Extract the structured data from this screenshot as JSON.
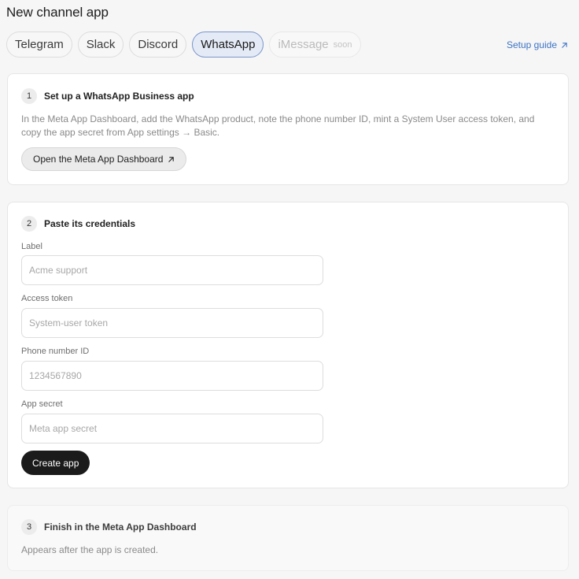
{
  "page": {
    "title": "New channel app"
  },
  "tabs": [
    {
      "label": "Telegram",
      "state": "default"
    },
    {
      "label": "Slack",
      "state": "default"
    },
    {
      "label": "Discord",
      "state": "default"
    },
    {
      "label": "WhatsApp",
      "state": "active"
    },
    {
      "label": "iMessage",
      "state": "disabled",
      "badge": "soon"
    }
  ],
  "setup_guide": {
    "label": "Setup guide",
    "icon": "arrow-up-right-icon"
  },
  "step1": {
    "number": "1",
    "title": "Set up a WhatsApp Business app",
    "description": "In the Meta App Dashboard, add the WhatsApp product, note the phone number ID, mint a System User access token, and copy the app secret from App settings → Basic.",
    "button_label": "Open the Meta App Dashboard",
    "button_icon": "arrow-up-right-icon"
  },
  "step2": {
    "number": "2",
    "title": "Paste its credentials",
    "fields": [
      {
        "label": "Label",
        "placeholder": "Acme support",
        "value": ""
      },
      {
        "label": "Access token",
        "placeholder": "System-user token",
        "value": ""
      },
      {
        "label": "Phone number ID",
        "placeholder": "1234567890",
        "value": ""
      },
      {
        "label": "App secret",
        "placeholder": "Meta app secret",
        "value": ""
      }
    ],
    "submit_label": "Create app"
  },
  "step3": {
    "number": "3",
    "title": "Finish in the Meta App Dashboard",
    "description": "Appears after the app is created."
  },
  "colors": {
    "accent": "#3d73c4",
    "active_tab_bg": "#e4ebf6",
    "active_tab_border": "#7a95c9",
    "primary_button": "#1b1b1b"
  }
}
